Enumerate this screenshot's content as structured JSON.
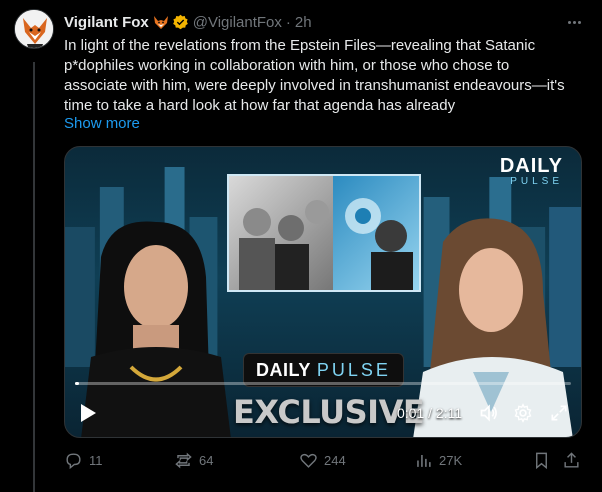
{
  "author": {
    "display_name": "Vigilant Fox",
    "handle": "@VigilantFox",
    "separator": "·",
    "time_ago": "2h",
    "emoji_icon": "fox-emoji-icon",
    "verified_color": "#f4b400"
  },
  "tweet": {
    "text": "In light of the revelations from the Epstein Files—revealing that Satanic p*dophiles working in collaboration with him, or those who chose to associate with him, were deeply involved in transhumanist endeavours—it's time to take a hard look at how far that agenda has already",
    "show_more_label": "Show more"
  },
  "video": {
    "logo_word1": "DAILY",
    "logo_word2": "PULSE",
    "banner_word1": "DAILY",
    "banner_word2": "PULSE",
    "overlay_title": "EXCLUSIVE",
    "timecode": "0:01 / 2:11",
    "progress": 0.008
  },
  "actions": {
    "replies": "11",
    "reposts": "64",
    "likes": "244",
    "views": "27K"
  },
  "colors": {
    "accent": "#1d9bf0",
    "muted": "#71767b",
    "background": "#000000"
  }
}
